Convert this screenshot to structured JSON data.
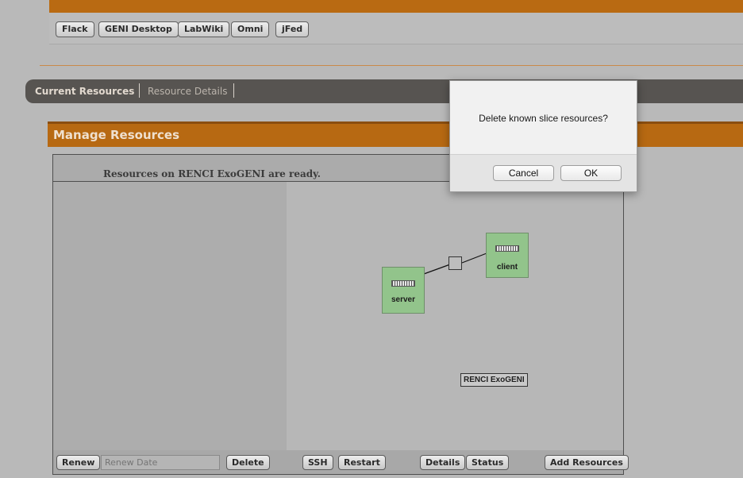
{
  "tool_buttons": [
    "Flack",
    "GENI Desktop",
    "LabWiki",
    "Omni",
    "jFed"
  ],
  "tabs": {
    "current": "Current Resources",
    "details": "Resource Details"
  },
  "panel": {
    "title": "Manage Resources",
    "status": "Resources on RENCI ExoGENI are ready."
  },
  "topology": {
    "nodes": [
      {
        "label": "server"
      },
      {
        "label": "client"
      }
    ],
    "aggregate": "RENCI ExoGENI"
  },
  "bottom": {
    "renew": "Renew",
    "renew_placeholder": "Renew Date",
    "delete": "Delete",
    "ssh": "SSH",
    "restart": "Restart",
    "details": "Details",
    "status": "Status",
    "add_resources": "Add Resources"
  },
  "dialog": {
    "message": "Delete known slice resources?",
    "cancel": "Cancel",
    "ok": "OK"
  },
  "colors": {
    "accent": "#b76912",
    "node_fill": "#92c48b",
    "tab_strip": "#575451"
  }
}
